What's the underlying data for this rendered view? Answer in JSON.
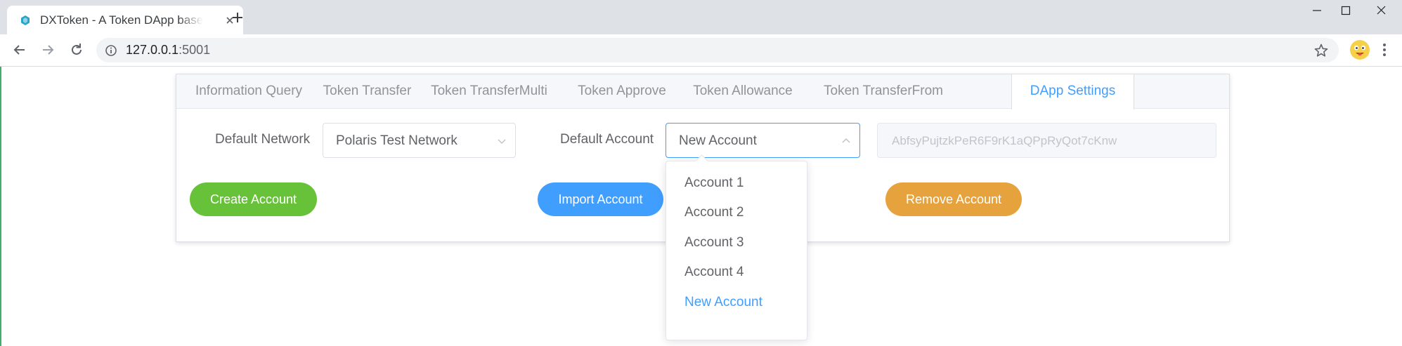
{
  "browser": {
    "tab_title": "DXToken - A Token DApp based on DXChain",
    "url_host": "127.0.0.1",
    "url_port": ":5001"
  },
  "page": {
    "tabs": [
      {
        "label": "Information Query"
      },
      {
        "label": "Token Transfer"
      },
      {
        "label": "Token TransferMulti"
      },
      {
        "label": "Token Approve"
      },
      {
        "label": "Token Allowance"
      },
      {
        "label": "Token TransferFrom"
      },
      {
        "label": "DApp Settings"
      }
    ],
    "active_tab": "DApp Settings",
    "settings": {
      "network_label": "Default Network",
      "network_value": "Polaris Test Network",
      "account_label": "Default Account",
      "account_value": "New Account",
      "address": "AbfsyPujtzkPeR6F9rK1aQPpRyQot7cKnw",
      "create_button": "Create Account",
      "import_button": "Import Account",
      "remove_button": "Remove Account"
    },
    "account_options": [
      "Account 1",
      "Account 2",
      "Account 3",
      "Account 4",
      "New Account"
    ],
    "selected_account": "New Account"
  },
  "colors": {
    "primary": "#409eff",
    "success": "#67c23a",
    "warning": "#e6a23c",
    "text": "#606266",
    "muted": "#909399"
  },
  "icons": [
    "dxtoken-favicon-icon",
    "close-icon",
    "plus-icon",
    "minimize-icon",
    "maximize-icon",
    "window-close-icon",
    "back-arrow-icon",
    "forward-arrow-icon",
    "reload-icon",
    "info-icon",
    "star-icon",
    "profile-avatar",
    "more-menu-icon",
    "chevron-down-icon",
    "chevron-up-icon"
  ]
}
